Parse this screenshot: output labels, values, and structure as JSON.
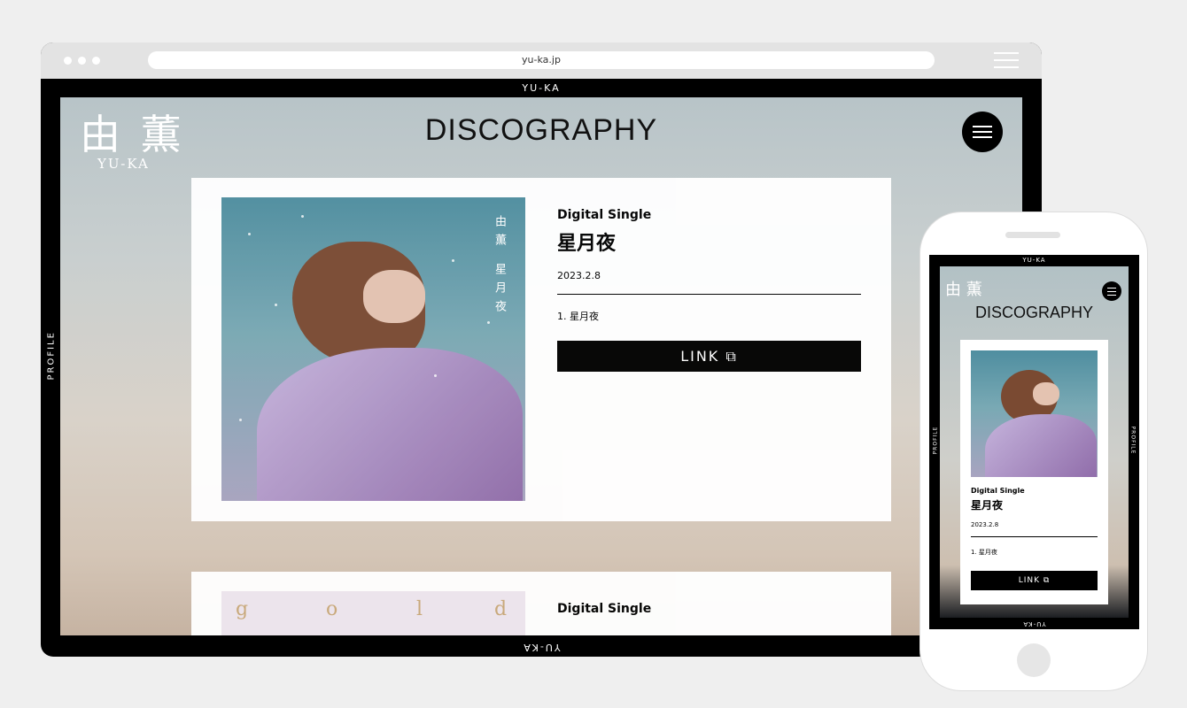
{
  "browser": {
    "url": "yu-ka.jp"
  },
  "site": {
    "frame_top": "YU-KA",
    "frame_bottom": "YU-KA",
    "frame_left": "PROFILE",
    "logo_kanji": "由 薫",
    "logo_latin": "YU-KA",
    "page_title": "DISCOGRAPHY"
  },
  "releases": [
    {
      "type": "Digital Single",
      "title": "星月夜",
      "date": "2023.2.8",
      "tracks": [
        "1. 星月夜"
      ],
      "link_label": "LINK",
      "cover_text": "由薫 星月夜"
    },
    {
      "type": "Digital Single",
      "cover_letters": [
        "g",
        "o",
        "l",
        "d"
      ]
    }
  ],
  "phone": {
    "frame_top": "YU-KA",
    "frame_bottom": "YU-KA",
    "frame_left": "PROFILE",
    "frame_right": "PROFILE",
    "logo_kanji": "由 薫",
    "page_title": "DISCOGRAPHY",
    "release": {
      "type": "Digital Single",
      "title": "星月夜",
      "date": "2023.2.8",
      "track": "1. 星月夜",
      "link_label": "LINK"
    }
  }
}
